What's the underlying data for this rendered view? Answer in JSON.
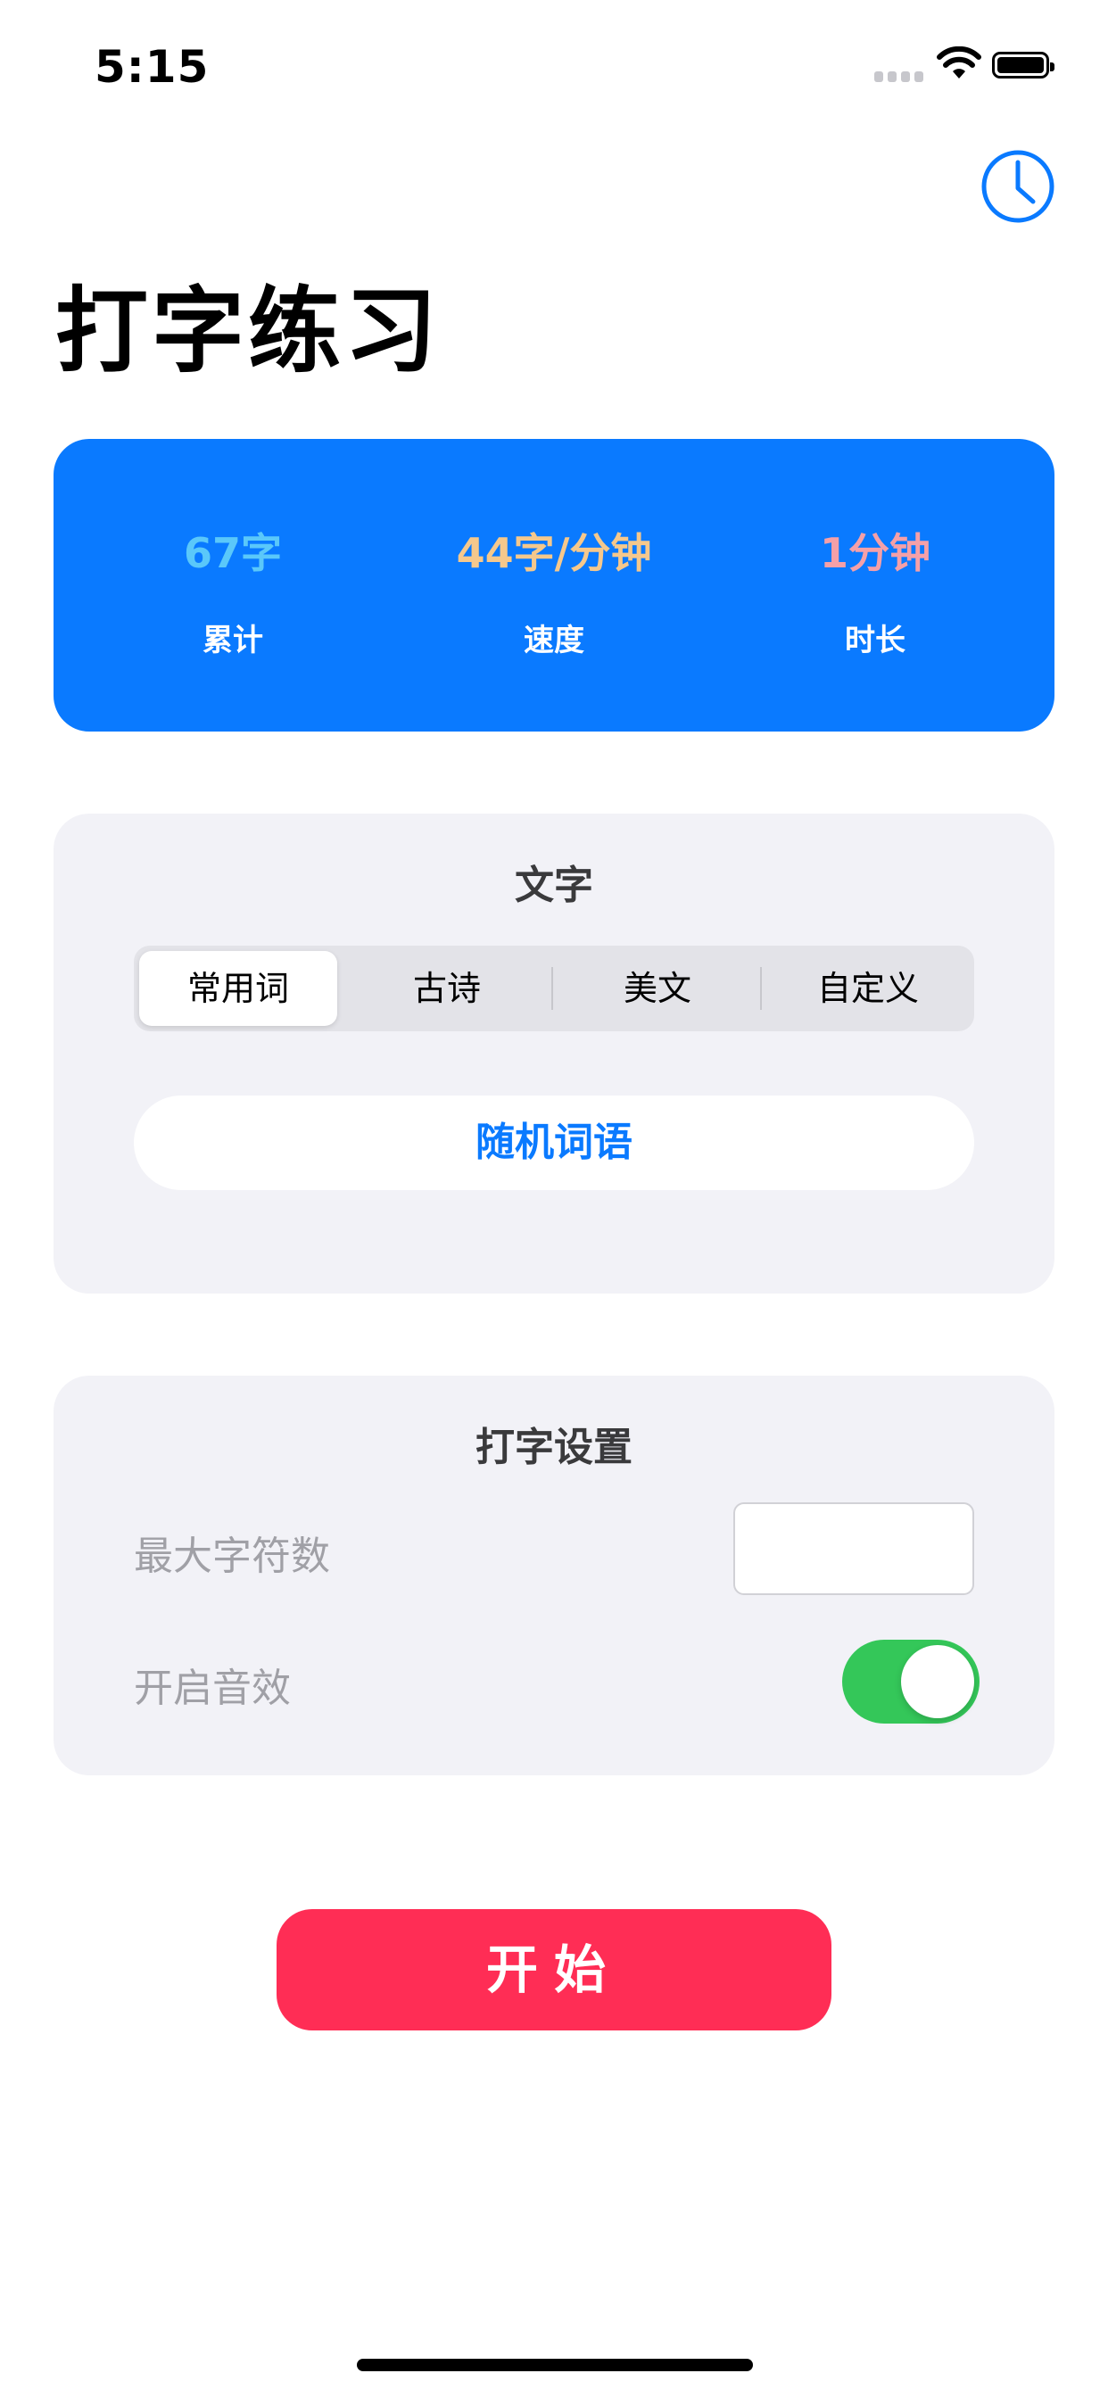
{
  "status_bar": {
    "time": "5:15"
  },
  "header": {
    "title": "打字练习",
    "history_icon": "clock-icon"
  },
  "stats": {
    "colors": {
      "card_background": "#0a7aff",
      "total_value": "#5ac8fa",
      "speed_value": "#f5c88c",
      "duration_value": "#f5a0a8"
    },
    "items": [
      {
        "value": "67字",
        "label": "累计"
      },
      {
        "value": "44字/分钟",
        "label": "速度"
      },
      {
        "value": "1分钟",
        "label": "时长"
      }
    ]
  },
  "text_panel": {
    "title": "文字",
    "segments": [
      {
        "label": "常用词",
        "selected": true
      },
      {
        "label": "古诗",
        "selected": false
      },
      {
        "label": "美文",
        "selected": false
      },
      {
        "label": "自定义",
        "selected": false
      }
    ],
    "random_button": "随机词语"
  },
  "settings_panel": {
    "title": "打字设置",
    "max_chars_label": "最大字符数",
    "max_chars_value": "",
    "sound_label": "开启音效",
    "sound_enabled": true
  },
  "start_button": "开始",
  "colors": {
    "accent_blue": "#0a7aff",
    "start_red": "#ff2d55",
    "toggle_green": "#34c759",
    "panel_bg": "#f2f2f7"
  }
}
